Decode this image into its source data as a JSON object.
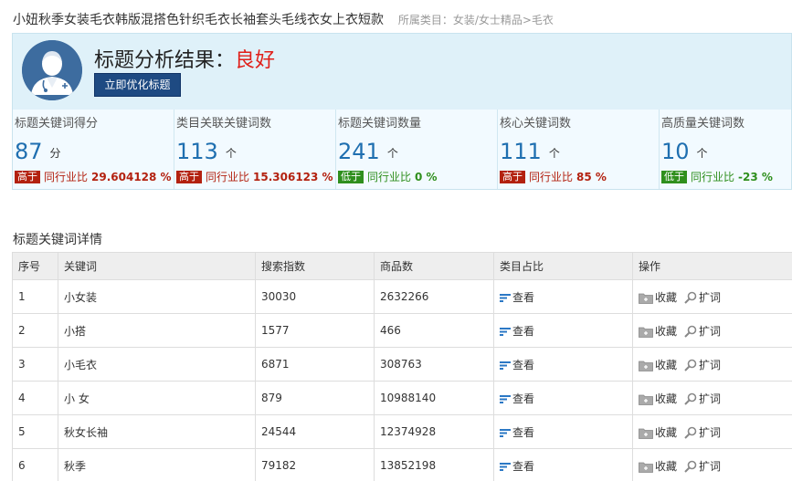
{
  "product": {
    "title": "小妞秋季女装毛衣韩版混搭色针织毛衣长袖套头毛线衣女上衣短款",
    "category": "所属类目：女装/女士精品>毛衣"
  },
  "result": {
    "label": "标题分析结果：",
    "grade": "良好",
    "optimize_button": "立即优化标题"
  },
  "metrics": [
    {
      "label": "标题关键词得分",
      "value": "87",
      "unit": "分",
      "badge": "高于",
      "badge_type": "high",
      "compare": "同行业比",
      "compare_value": "29.604128 %"
    },
    {
      "label": "类目关联关键词数",
      "value": "113",
      "unit": "个",
      "badge": "高于",
      "badge_type": "high",
      "compare": "同行业比",
      "compare_value": "15.306123 %"
    },
    {
      "label": "标题关键词数量",
      "value": "241",
      "unit": "个",
      "badge": "低于",
      "badge_type": "low",
      "compare": "同行业比",
      "compare_value": "0 %"
    },
    {
      "label": "核心关键词数",
      "value": "111",
      "unit": "个",
      "badge": "高于",
      "badge_type": "high",
      "compare": "同行业比",
      "compare_value": "85 %"
    },
    {
      "label": "高质量关键词数",
      "value": "10",
      "unit": "个",
      "badge": "低于",
      "badge_type": "low",
      "compare": "同行业比",
      "compare_value": "-23 %"
    }
  ],
  "section_title": "标题关键词详情",
  "table": {
    "headers": [
      "序号",
      "关键词",
      "搜索指数",
      "商品数",
      "类目占比",
      "操作"
    ],
    "rows": [
      {
        "no": "1",
        "keyword": "小女装",
        "search": "30030",
        "goods": "2632266"
      },
      {
        "no": "2",
        "keyword": "小搭",
        "search": "1577",
        "goods": "466"
      },
      {
        "no": "3",
        "keyword": "小毛衣",
        "search": "6871",
        "goods": "308763"
      },
      {
        "no": "4",
        "keyword": "小 女",
        "search": "879",
        "goods": "10988140"
      },
      {
        "no": "5",
        "keyword": "秋女长袖",
        "search": "24544",
        "goods": "12374928"
      },
      {
        "no": "6",
        "keyword": "秋季",
        "search": "79182",
        "goods": "13852198"
      }
    ],
    "view_label": "查看",
    "fav_label": "收藏",
    "expand_label": "扩词"
  },
  "colors": {
    "accent": "#1f6fb0",
    "good": "#e0201a",
    "high_badge": "#b3210f",
    "low_badge": "#2f8f1d",
    "button": "#1e4a82"
  },
  "icons": {
    "avatar": "doctor-avatar-icon",
    "view": "bar-chart-icon",
    "favorite": "folder-add-icon",
    "expand": "magnifier-icon"
  }
}
